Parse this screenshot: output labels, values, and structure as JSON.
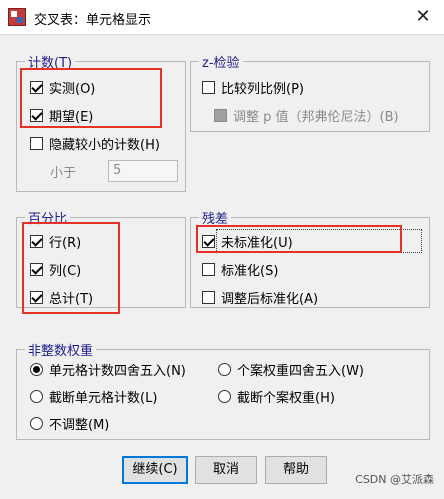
{
  "window": {
    "title": "交叉表：单元格显示",
    "close_glyph": "✕"
  },
  "counts": {
    "legend": "计数(T)",
    "observed": "实测(O)",
    "expected": "期望(E)",
    "hide_small": "隐藏较小的计数(H)",
    "less_than_label": "小于",
    "less_than_value": "5"
  },
  "ztest": {
    "legend": "z-检验",
    "compare": "比较列比例(P)",
    "adjust": "调整 p 值（邦弗伦尼法）(B)"
  },
  "percentages": {
    "legend": "百分比",
    "row": "行(R)",
    "column": "列(C)",
    "total": "总计(T)"
  },
  "residuals": {
    "legend": "残差",
    "unstandardized": "未标准化(U)",
    "standardized": "标准化(S)",
    "adjusted": "调整后标准化(A)"
  },
  "weights": {
    "legend": "非整数权重",
    "round_cell": "单元格计数四舍五入(N)",
    "round_case": "个案权重四舍五入(W)",
    "truncate_cell": "截断单元格计数(L)",
    "truncate_case": "截断个案权重(H)",
    "no_adjust": "不调整(M)"
  },
  "buttons": {
    "continue": "继续(C)",
    "cancel": "取消",
    "help": "帮助"
  },
  "watermark": "CSDN @艾派森"
}
